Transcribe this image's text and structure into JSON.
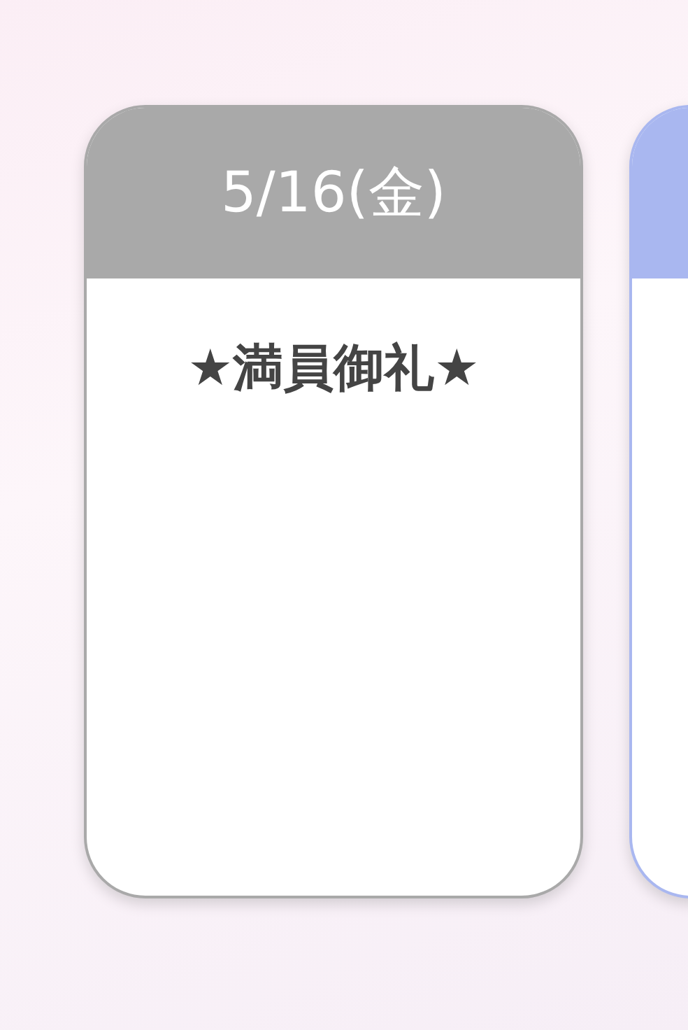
{
  "cards": [
    {
      "date": "5/16(金)",
      "status": "★満員御礼★",
      "color": "#a9a9a9"
    },
    {
      "color": "#a9b7f0"
    }
  ]
}
